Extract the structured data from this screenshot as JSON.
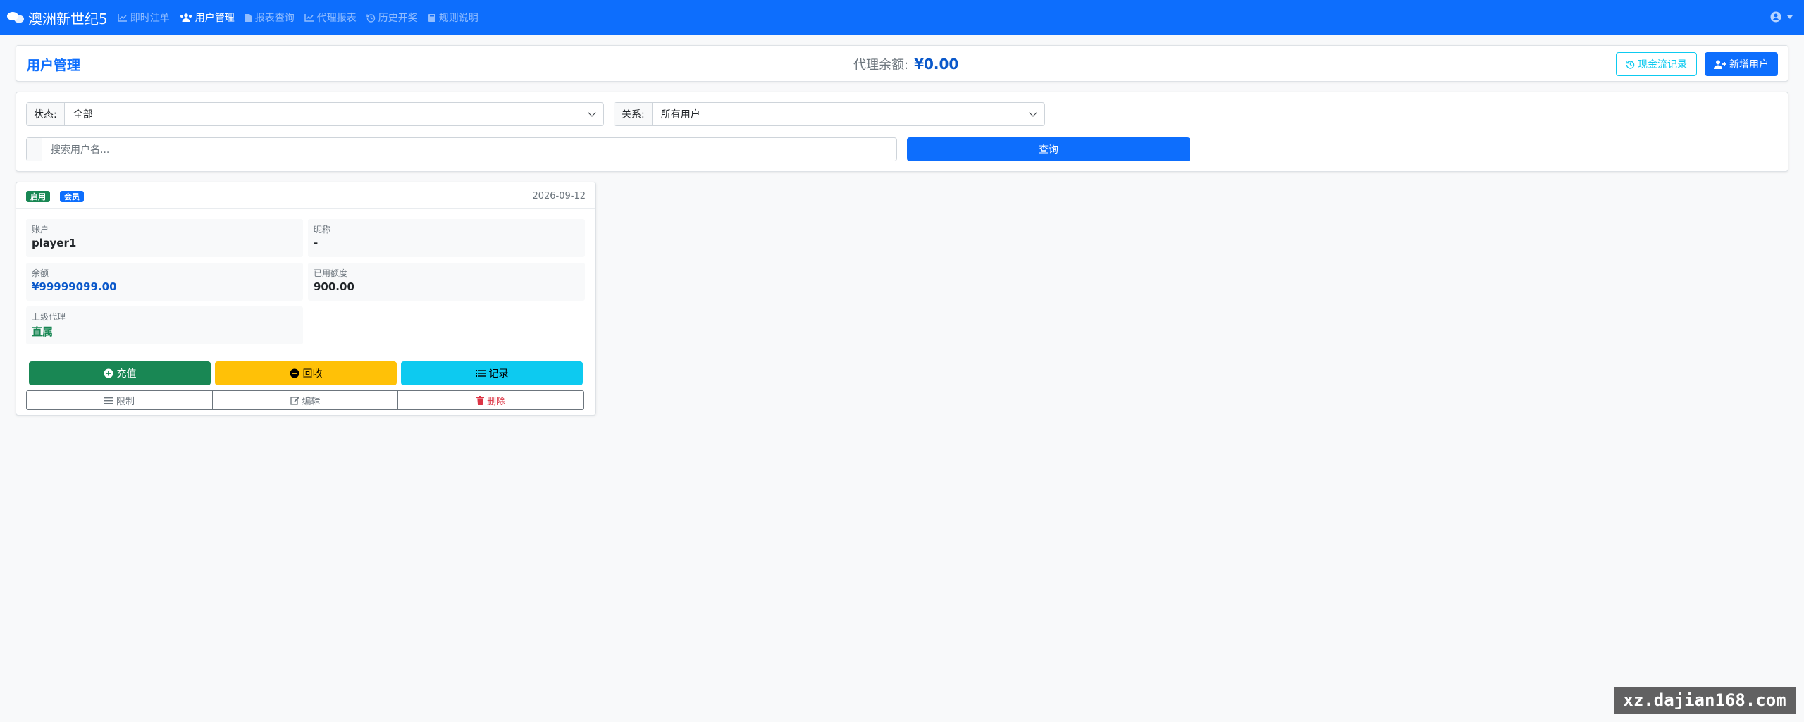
{
  "navbar": {
    "brand": "澳洲新世纪5",
    "items": [
      {
        "label": "即时注单",
        "icon": "chart-line-icon"
      },
      {
        "label": "用户管理",
        "icon": "users-icon"
      },
      {
        "label": "报表查询",
        "icon": "file-icon"
      },
      {
        "label": "代理报表",
        "icon": "chart-line-icon"
      },
      {
        "label": "历史开奖",
        "icon": "history-icon"
      },
      {
        "label": "规则说明",
        "icon": "book-icon"
      }
    ],
    "active_item": "用户管理",
    "user_icon": "user-circle-icon"
  },
  "header": {
    "title": "用户管理",
    "balance_label": "代理余额:",
    "balance_value": "¥0.00",
    "cash_flow_button": "现金流记录",
    "add_user_button": "新增用户"
  },
  "filters": {
    "status_label": "状态:",
    "status_value": "全部",
    "relation_label": "关系:",
    "relation_value": "所有用户",
    "search_placeholder": "搜索用户名...",
    "query_button": "查询"
  },
  "users": [
    {
      "badges": [
        "启用",
        "会员"
      ],
      "date": "2026-09-12",
      "account_label": "账户",
      "account": "player1",
      "nickname_label": "昵称",
      "nickname": "-",
      "balance_label": "余额",
      "balance": "¥99999099.00",
      "used_credit_label": "已用额度",
      "used_credit": "900.00",
      "parent_agent_label": "上级代理",
      "parent_agent": "直属",
      "actions": {
        "recharge": "充值",
        "recover": "回收",
        "records": "记录",
        "limit": "限制",
        "edit": "编辑",
        "delete": "删除"
      }
    }
  ],
  "watermark": "xz.dajian168.com",
  "colors": {
    "primary": "#0d6efd",
    "success": "#198754",
    "warning": "#ffc107",
    "info": "#0dcaf0",
    "danger": "#dc3545"
  }
}
